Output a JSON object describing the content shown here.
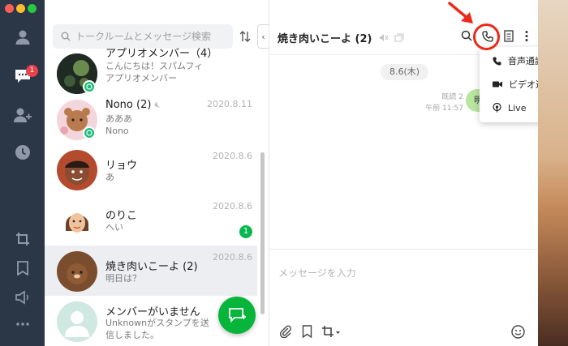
{
  "rail": {
    "chat_badge": "1"
  },
  "chat_list": {
    "search_placeholder": "トークルームとメッセージ検索",
    "collapse_label": "‹",
    "rows": [
      {
        "name": "アプリオメンバー（4）",
        "preview_line1": "こんにちは！スパムフィ",
        "preview_line2": "アプリオメンバー",
        "date": "",
        "unread": ""
      },
      {
        "name": "Nono (2)",
        "preview_line1": "あああ",
        "preview_line2": "Nono",
        "date": "2020.8.11",
        "unread": ""
      },
      {
        "name": "リョウ",
        "preview_line1": "あ",
        "preview_line2": "",
        "date": "2020.8.6",
        "unread": ""
      },
      {
        "name": "のりこ",
        "preview_line1": "へい",
        "preview_line2": "",
        "date": "2020.8.6",
        "unread": "1"
      },
      {
        "name": "焼き肉いこーよ (2)",
        "preview_line1": "明日は？",
        "preview_line2": "",
        "date": "2020.8.6",
        "unread": ""
      },
      {
        "name": "メンバーがいません",
        "preview_line1": "Unknownがスタンプを送",
        "preview_line2": "信しました。",
        "date": "",
        "unread": ""
      }
    ]
  },
  "chat": {
    "title": "焼き肉いこーよ (2)",
    "date_divider": "8.6(木)",
    "read_status": "既読 2",
    "time": "午前 11:57",
    "bubble_text": "明",
    "input_placeholder": "メッセージを入力"
  },
  "call_menu": {
    "items": [
      {
        "label": "音声通話",
        "icon": "phone-icon"
      },
      {
        "label": "ビデオ通話",
        "icon": "video-camera-icon"
      },
      {
        "label": "Live",
        "icon": "live-broadcast-icon"
      }
    ]
  },
  "colors": {
    "rail": "#2b3646",
    "accent_green": "#07b53b",
    "annotation_red": "#ea2a1a",
    "badge_red": "#e8424d"
  }
}
